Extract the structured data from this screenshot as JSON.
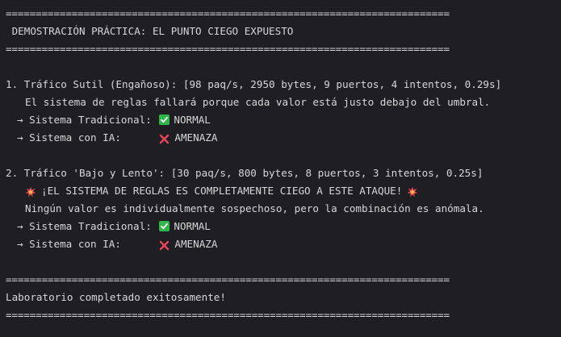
{
  "separator": "==========================================================================",
  "header": {
    "title": " DEMOSTRACIÓN PRÁCTICA: EL PUNTO CIEGO EXPUESTO"
  },
  "case1": {
    "heading": "1. Tráfico Sutil (Engañoso): [98 paq/s, 2950 bytes, 9 puertos, 4 intentos, 0.29s]",
    "note": "El sistema de reglas fallará porque cada valor está justo debajo del umbral.",
    "traditional_label": "→ Sistema Tradicional: ",
    "traditional_result": "NORMAL",
    "ai_label": "→ Sistema con IA:      ",
    "ai_result": "AMENAZA"
  },
  "case2": {
    "heading": "2. Tráfico 'Bajo y Lento': [30 paq/s, 800 bytes, 8 puertos, 3 intentos, 0.25s]",
    "alert": "¡EL SISTEMA DE REGLAS ES COMPLETAMENTE CIEGO A ESTE ATAQUE!",
    "note": "Ningún valor es individualmente sospechoso, pero la combinación es anómala.",
    "traditional_label": "→ Sistema Tradicional: ",
    "traditional_result": "NORMAL",
    "ai_label": "→ Sistema con IA:      ",
    "ai_result": "AMENAZA"
  },
  "footer": {
    "message": "Laboratorio completado exitosamente!"
  },
  "colors": {
    "background": "#1f1f23",
    "text": "#d7d7d7",
    "check": "#2fb54a",
    "cross": "#e8455a",
    "boom": "#e8455a"
  }
}
